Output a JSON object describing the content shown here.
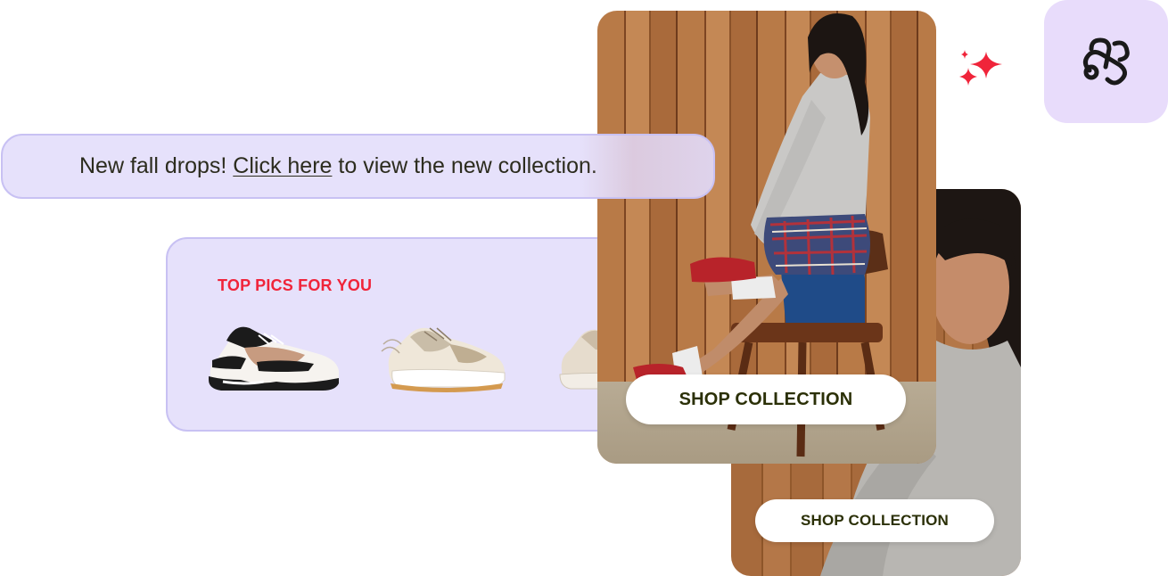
{
  "banner": {
    "text_before": "New fall drops! ",
    "link_label": "Click here",
    "text_after": " to view the new collection."
  },
  "picks": {
    "title": "TOP PICS FOR YOU",
    "items": [
      {
        "icon": "sneaker-black-tan-icon"
      },
      {
        "icon": "sneaker-cream-icon"
      },
      {
        "icon": "sneaker-beige-icon"
      }
    ]
  },
  "collection_front": {
    "button_label": "SHOP COLLECTION"
  },
  "collection_back": {
    "button_label": "SHOP COLLECTION"
  },
  "decor": {
    "sparkles_icon": "sparkles-icon",
    "logo_icon": "link-logo-icon"
  },
  "colors": {
    "lavender_bg": "#e6e1fb",
    "lavender_border": "#c8c1f3",
    "accent_red": "#f0243a",
    "logo_tile": "#e8dcfb",
    "button_text": "#2b3007"
  }
}
